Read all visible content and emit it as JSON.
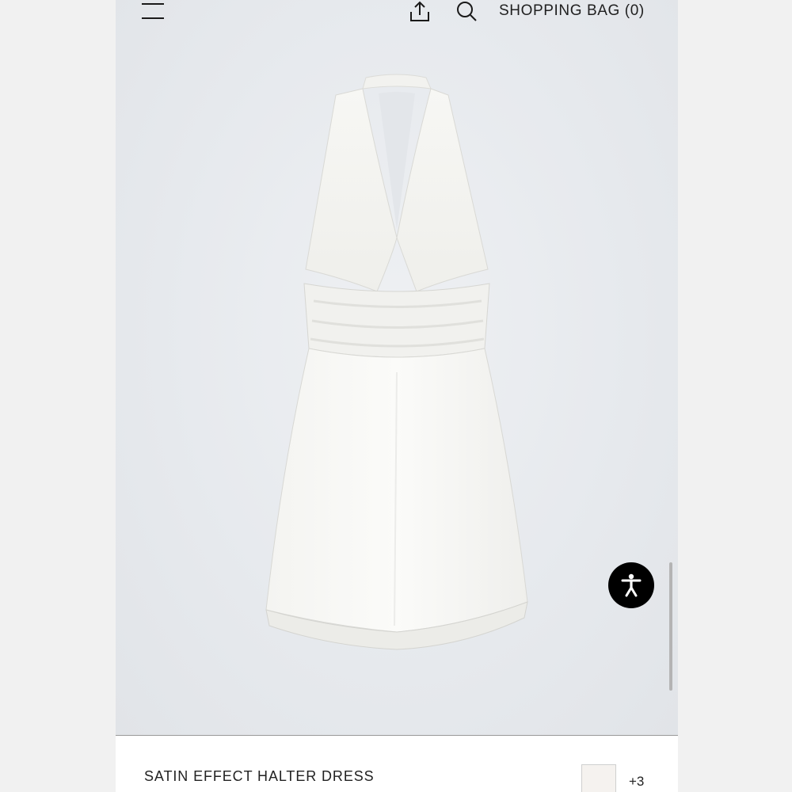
{
  "header": {
    "shopping_bag_label": "SHOPPING BAG (0)",
    "icons": [
      "menu-icon",
      "share-icon",
      "search-icon"
    ]
  },
  "product": {
    "title": "SATIN EFFECT HALTER DRESS",
    "more_colors": "+3",
    "swatch_color": "#f5f2ef"
  },
  "accessibility": {
    "icon": "accessibility-icon"
  }
}
